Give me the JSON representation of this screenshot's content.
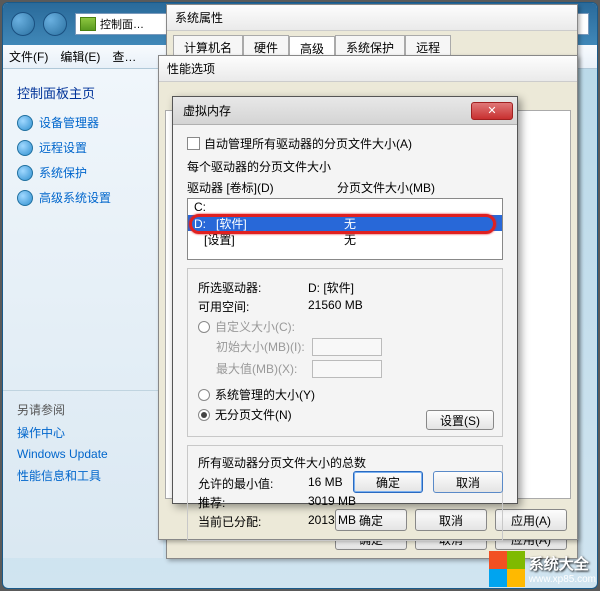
{
  "explorer": {
    "breadcrumb": "控制面…",
    "menu": {
      "file": "文件(F)",
      "edit": "编辑(E)",
      "view": "查…"
    },
    "sidebar": {
      "title": "控制面板主页",
      "items": [
        {
          "label": "设备管理器"
        },
        {
          "label": "远程设置"
        },
        {
          "label": "系统保护"
        },
        {
          "label": "高级系统设置"
        }
      ],
      "seealso_title": "另请参阅",
      "links": [
        {
          "label": "操作中心"
        },
        {
          "label": "Windows Update"
        },
        {
          "label": "性能信息和工具"
        }
      ]
    }
  },
  "sysprops": {
    "title": "系统属性",
    "tabs": {
      "computer": "计算机名",
      "hardware": "硬件",
      "advanced": "高级",
      "protect": "系统保护",
      "remote": "远程"
    },
    "computer_name_label": "计算机名",
    "buttons": {
      "ok": "确定",
      "cancel": "取消",
      "apply": "应用(A)"
    }
  },
  "perfopts": {
    "title": "性能选项",
    "buttons": {
      "ok": "确定",
      "cancel": "取消",
      "apply": "应用(A)"
    }
  },
  "vmem": {
    "title": "虚拟内存",
    "auto_manage": "自动管理所有驱动器的分页文件大小(A)",
    "each_drive": "每个驱动器的分页文件大小",
    "col_drive": "驱动器 [卷标](D)",
    "col_size": "分页文件大小(MB)",
    "drives": [
      {
        "letter": "C:",
        "label": "",
        "size": ""
      },
      {
        "letter": "D:",
        "label": "[软件]",
        "size": "无"
      },
      {
        "letter": "",
        "label": "[设置]",
        "size": "无"
      }
    ],
    "selected_drive_label": "所选驱动器:",
    "selected_drive_value": "D:   [软件]",
    "free_space_label": "可用空间:",
    "free_space_value": "21560 MB",
    "custom_size": "自定义大小(C):",
    "initial_size": "初始大小(MB)(I):",
    "max_size": "最大值(MB)(X):",
    "system_managed": "系统管理的大小(Y)",
    "no_paging": "无分页文件(N)",
    "set_btn": "设置(S)",
    "totals_title": "所有驱动器分页文件大小的总数",
    "min_allowed_label": "允许的最小值:",
    "min_allowed_value": "16 MB",
    "recommended_label": "推荐:",
    "recommended_value": "3019 MB",
    "current_label": "当前已分配:",
    "current_value": "2013 MB",
    "ok": "确定",
    "cancel": "取消"
  },
  "watermark": {
    "brand": "系统大全",
    "url": "www.xp85.com"
  }
}
